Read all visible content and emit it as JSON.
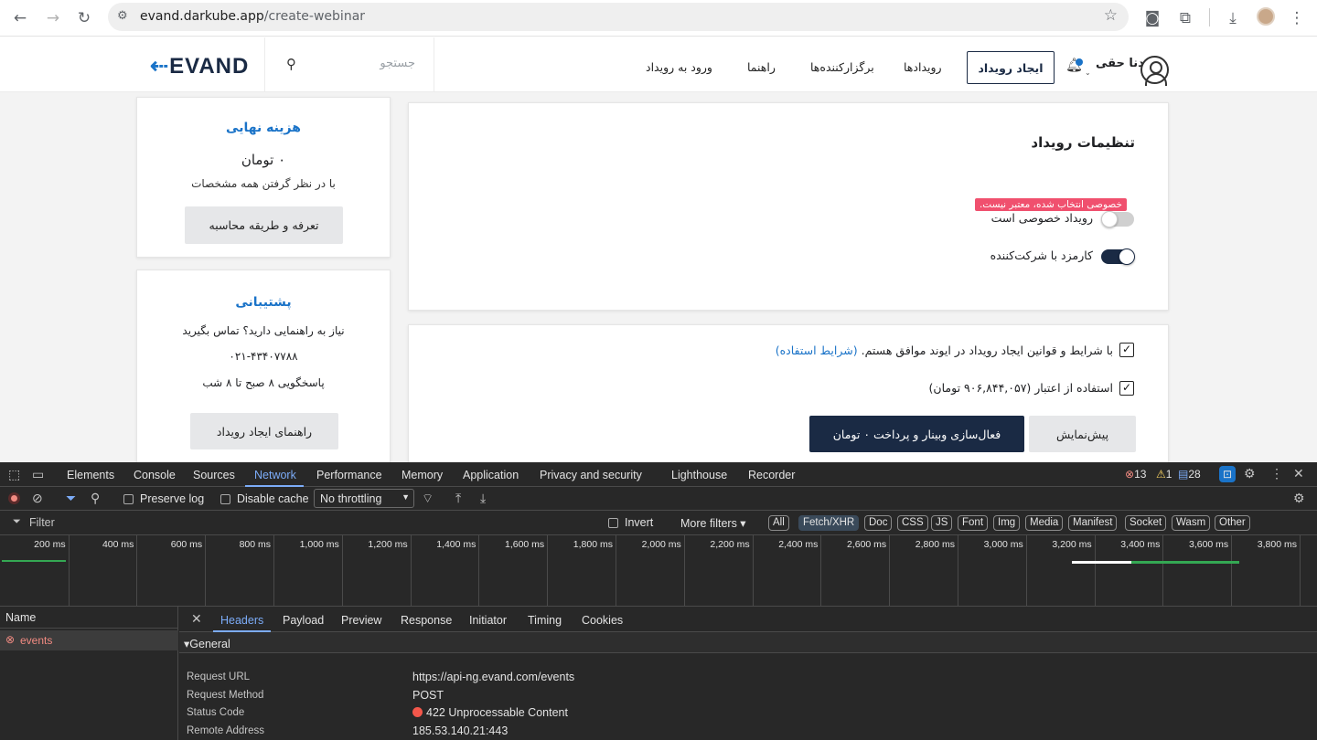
{
  "browser": {
    "url_host": "evand.darkube.app",
    "url_path": "/create-webinar"
  },
  "header": {
    "logo_text": "EVAND",
    "search_placeholder": "جستجو",
    "nav": [
      "ورود به رویداد",
      "راهنما",
      "برگزارکننده‌ها",
      "رویدادها"
    ],
    "create_button": "ایجاد رویداد",
    "user_name": "دنا حقی"
  },
  "cost_card": {
    "title": "هزینه نهایی",
    "amount": "۰ تومان",
    "note": "با در نظر گرفتن همه مشخصات",
    "button": "تعرفه و طریقه محاسبه"
  },
  "support_card": {
    "title": "پشتیبانی",
    "line1": "نیاز به راهنمایی دارید؟ تماس بگیرید",
    "phone": "۰۲۱-۴۳۴۰۷۷۸۸",
    "hours": "پاسخگویی ۸ صبح تا ۸ شب",
    "button": "راهنمای ایجاد رویداد"
  },
  "settings_card": {
    "title": "تنظیمات رویداد",
    "error_badge": "خصوصی انتخاب شده، معتبر نیست.",
    "private_label": "رویداد خصوصی است",
    "private_on": false,
    "fee_label": "کارمزد با شرکت‌کننده",
    "fee_on": true
  },
  "confirm_card": {
    "terms_text": "با شرایط و قوانین ایجاد رویداد در ایوند موافق هستم.",
    "terms_link": "(شرایط استفاده)",
    "credit_text": "استفاده از اعتبار (۹۰۶,۸۴۴,۰۵۷ تومان)",
    "submit_button": "فعال‌سازی وبینار و پرداخت ۰ تومان",
    "preview_button": "پیش‌نمایش"
  },
  "devtools": {
    "tabs": [
      "Elements",
      "Console",
      "Sources",
      "Network",
      "Performance",
      "Memory",
      "Application",
      "Privacy and security",
      "Lighthouse",
      "Recorder"
    ],
    "active_tab": "Network",
    "errors": "13",
    "warnings": "1",
    "messages": "28",
    "preserve_log": "Preserve log",
    "disable_cache": "Disable cache",
    "throttling": "No throttling",
    "filter_placeholder": "Filter",
    "invert": "Invert",
    "more_filters": "More filters",
    "type_chips": [
      "All",
      "Fetch/XHR",
      "Doc",
      "CSS",
      "JS",
      "Font",
      "Img",
      "Media",
      "Manifest",
      "Socket",
      "Wasm",
      "Other"
    ],
    "selected_chip": "Fetch/XHR",
    "timeline_ticks": [
      "200 ms",
      "400 ms",
      "600 ms",
      "800 ms",
      "1,000 ms",
      "1,200 ms",
      "1,400 ms",
      "1,600 ms",
      "1,800 ms",
      "2,000 ms",
      "2,200 ms",
      "2,400 ms",
      "2,600 ms",
      "2,800 ms",
      "3,000 ms",
      "3,200 ms",
      "3,400 ms",
      "3,600 ms",
      "3,800 ms"
    ],
    "name_header": "Name",
    "request_name": "events",
    "detail_tabs": [
      "Headers",
      "Payload",
      "Preview",
      "Response",
      "Initiator",
      "Timing",
      "Cookies"
    ],
    "active_detail_tab": "Headers",
    "general_label": "General",
    "general": [
      {
        "key": "Request URL",
        "value": "https://api-ng.evand.com/events"
      },
      {
        "key": "Request Method",
        "value": "POST"
      },
      {
        "key": "Status Code",
        "value": "422 Unprocessable Content"
      },
      {
        "key": "Remote Address",
        "value": "185.53.140.21:443"
      }
    ]
  }
}
